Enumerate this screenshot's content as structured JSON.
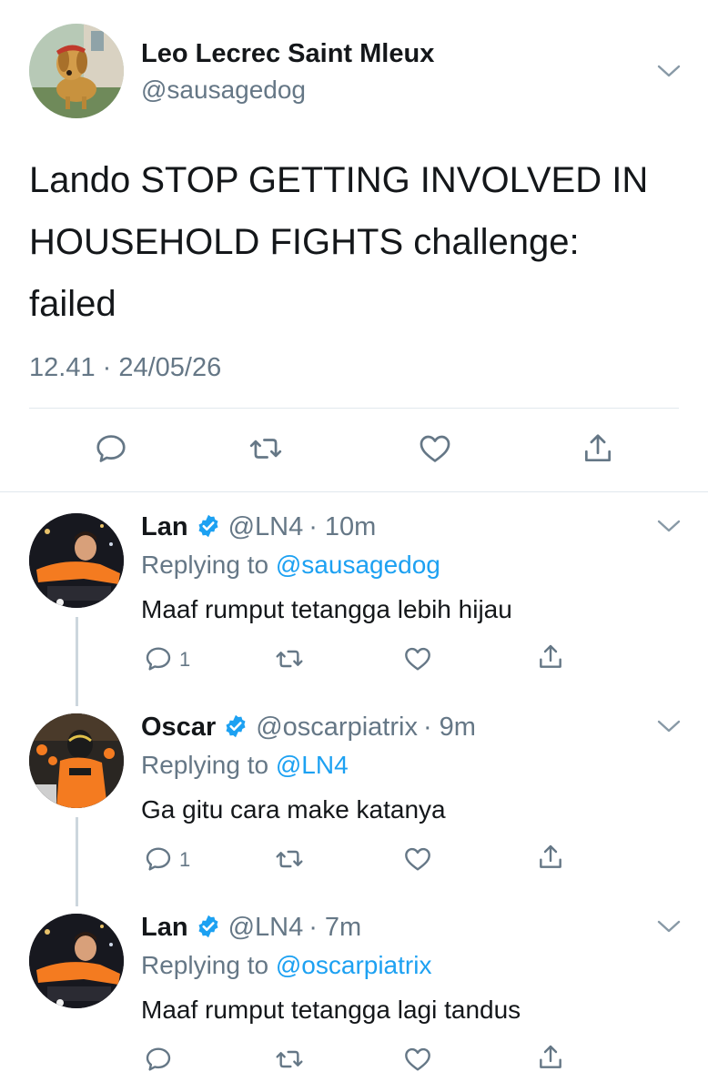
{
  "main_tweet": {
    "name": "Leo Lecrec Saint Mleux",
    "handle": "@sausagedog",
    "text": "Lando STOP GETTING INVOLVED IN HOUSEHOLD FIGHTS challenge: failed",
    "timestamp": "12.41 · 24/05/26",
    "actions": [
      "reply-icon",
      "retweet-icon",
      "like-icon",
      "share-icon"
    ]
  },
  "replies": [
    {
      "name": "Lan",
      "verified": true,
      "handle": "@LN4",
      "time": "· 10m",
      "replying_prefix": "Replying to",
      "replying_to": "@sausagedog",
      "text": "Maaf rumput tetangga lebih hijau",
      "reply_count": "1"
    },
    {
      "name": "Oscar",
      "verified": true,
      "handle": "@oscarpiatrix",
      "time": "· 9m",
      "replying_prefix": "Replying to",
      "replying_to": "@LN4",
      "text": "Ga gitu cara make katanya",
      "reply_count": "1"
    },
    {
      "name": "Lan",
      "verified": true,
      "handle": "@LN4",
      "time": "· 7m",
      "replying_prefix": "Replying to",
      "replying_to": "@oscarpiatrix",
      "text": "Maaf rumput tetangga lagi tandus",
      "reply_count": ""
    }
  ],
  "colors": {
    "text": "#14171a",
    "secondary": "#657786",
    "link": "#1da1f2",
    "divider": "#e1e8ed",
    "thread_line": "#ccd6dd",
    "orange": "#f47b20"
  }
}
